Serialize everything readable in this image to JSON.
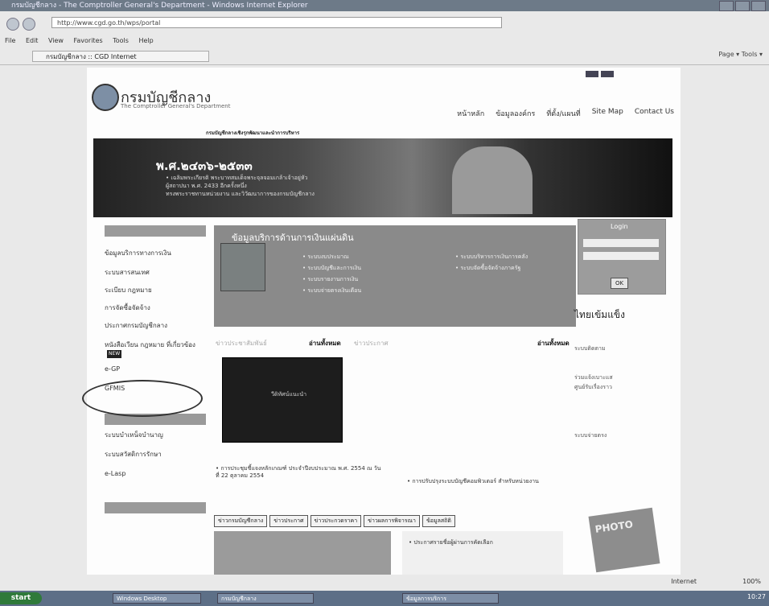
{
  "window": {
    "title": "กรมบัญชีกลาง - The Comptroller General's Department - Windows Internet Explorer",
    "url": "http://www.cgd.go.th/wps/portal",
    "tab": "กรมบัญชีกลาง :: CGD Internet",
    "menu": [
      "File",
      "Edit",
      "View",
      "Favorites",
      "Tools",
      "Help"
    ],
    "commands": "Page ▾  Tools ▾"
  },
  "site": {
    "logo_title": "กรมบัญชีกลาง",
    "logo_subtitle": "The Comptroller General's Department",
    "tagline": "กรมบัญชีกลางเชิงรุกพัฒนาและนำการบริหาร",
    "nav": [
      "หน้าหลัก",
      "ข้อมูลองค์กร",
      "ที่ตั้ง/แผนที่",
      "Site Map",
      "Contact Us"
    ]
  },
  "banner": {
    "title": "พ.ศ.๒๔๓๖-๒๕๓๓",
    "lines": [
      "• เฉลิมพระเกียรติ พระบาทสมเด็จพระจุลจอมเกล้าเจ้าอยู่หัว",
      "ผู้สถาปนา พ.ศ. 2433 อีกครั้งหนึ่ง",
      "ทรงพระราชทานหน่วยงาน และวิวัฒนาการของกรมบัญชีกลาง"
    ]
  },
  "sidebar": {
    "items": [
      "ข้อมูลบริการทางการเงิน",
      "ระบบสารสนเทศ",
      "ระเบียบ กฎหมาย",
      "การจัดซื้อจัดจ้าง",
      "ประกาศกรมบัญชีกลาง",
      "หนังสือเวียน กฎหมาย ที่เกี่ยวข้อง",
      "e-GP",
      "GFMIS"
    ],
    "new_badge": "NEW",
    "section2_items": [
      "ระบบบำเหน็จบำนาญ",
      "ระบบสวัสดิการรักษา",
      "e-Lasp"
    ]
  },
  "feature": {
    "title": "ข้อมูลบริการด้านการเงินแผ่นดิน",
    "links": [
      "• ระบบงบประมาณ",
      "• ระบบบัญชีและการเงิน",
      "• ระบบรายงานการเงิน",
      "• ระบบจ่ายตรงเงินเดือน"
    ],
    "links_right": [
      "• ระบบบริหารการเงินการคลัง",
      "• ระบบจัดซื้อจัดจ้างภาครัฐ"
    ]
  },
  "announcements": {
    "left_heading": "ข่าวประชาสัมพันธ์",
    "left_more": "อ่านทั้งหมด",
    "mid_heading": "ข่าวประกาศ",
    "right_more": "อ่านทั้งหมด",
    "video_caption": "วีดิทัศน์แนะนำ",
    "news_left": "• การประชุมชี้แจงหลักเกณฑ์ ประจำปีงบประมาณ พ.ศ. 2554 ณ วันที่ 22 ตุลาคม 2554",
    "news_right": "• การปรับปรุงระบบบัญชีคอมพิวเตอร์ สำหรับหน่วยงาน"
  },
  "bottom_tabs": [
    "ข่าวกรมบัญชีกลาง",
    "ข่าวประกาศ",
    "ข่าวประกวดราคา",
    "ข่าวผลการพิจารณา",
    "ข้อมูลสถิติ"
  ],
  "bottom_panel_text": "• ประกาศรายชื่อผู้ผ่านการคัดเลือก",
  "right": {
    "login_title": "Login",
    "ok": "OK",
    "slogan": "ไทยเข้มแข็ง",
    "links": [
      "ระบบติดตาม",
      "ร่วมแจ้งเบาะแส",
      "ศูนย์รับเรื่องราว",
      "ระบบจ่ายตรง"
    ],
    "photo": "PHOTO"
  },
  "status": {
    "zone": "Internet",
    "zoom": "100%"
  },
  "taskbar": {
    "start": "start",
    "tasks": [
      "Windows Desktop",
      "กรมบัญชีกลาง",
      "ข้อมูลการบริการ"
    ],
    "clock": "10:27"
  }
}
